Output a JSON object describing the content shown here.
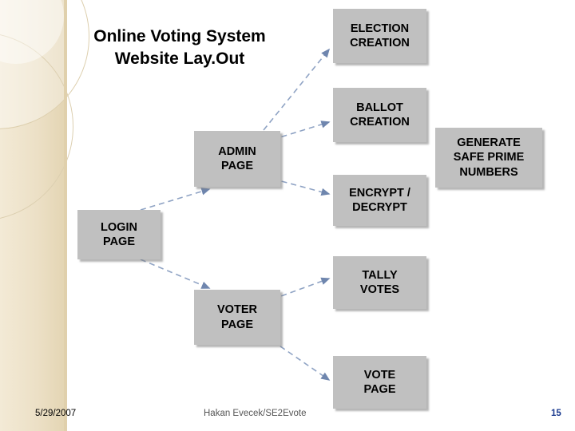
{
  "slide": {
    "title_line1": "Online Voting System",
    "title_line2": "Website Lay.Out",
    "footer": {
      "date": "5/29/2007",
      "center": "Hakan Evecek/SE2Evote",
      "page_number": "15"
    },
    "colors": {
      "node_fill": "#c0c0c0",
      "band_fill": "#ece0c6",
      "connector": "#7b8fb5",
      "page_number": "#1a3a8f"
    }
  },
  "diagram": {
    "type": "flow",
    "nodes": [
      {
        "id": "login-page",
        "line1": "LOGIN",
        "line2": "PAGE"
      },
      {
        "id": "admin-page",
        "line1": "ADMIN",
        "line2": "PAGE"
      },
      {
        "id": "voter-page",
        "line1": "VOTER",
        "line2": "PAGE"
      },
      {
        "id": "election-creation",
        "line1": "ELECTION",
        "line2": "CREATION"
      },
      {
        "id": "ballot-creation",
        "line1": "BALLOT",
        "line2": "CREATION"
      },
      {
        "id": "encrypt-decrypt",
        "line1": "ENCRYPT /",
        "line2": "DECRYPT"
      },
      {
        "id": "tally-votes",
        "line1": "TALLY",
        "line2": "VOTES"
      },
      {
        "id": "vote-page",
        "line1": "VOTE",
        "line2": "PAGE"
      },
      {
        "id": "generate-safe-prime",
        "line1": "GENERATE",
        "line2": "SAFE PRIME",
        "line3": "NUMBERS"
      }
    ],
    "edges": [
      {
        "from": "login-page",
        "to": "admin-page"
      },
      {
        "from": "login-page",
        "to": "voter-page"
      },
      {
        "from": "admin-page",
        "to": "election-creation"
      },
      {
        "from": "admin-page",
        "to": "ballot-creation"
      },
      {
        "from": "admin-page",
        "to": "encrypt-decrypt"
      },
      {
        "from": "voter-page",
        "to": "tally-votes"
      },
      {
        "from": "voter-page",
        "to": "vote-page"
      }
    ]
  }
}
